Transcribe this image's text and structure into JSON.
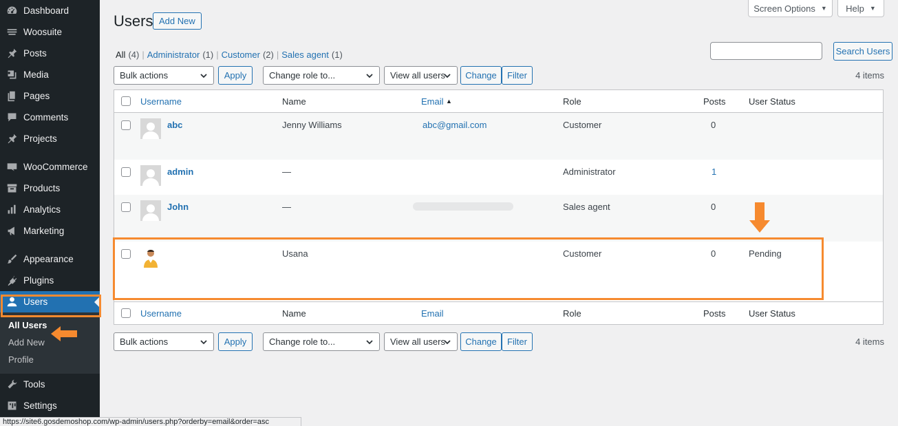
{
  "sidebar": {
    "items": [
      {
        "label": "Dashboard",
        "icon": "dashboard-icon"
      },
      {
        "label": "Woosuite",
        "icon": "woosuite-icon"
      },
      {
        "label": "Posts",
        "icon": "pin-icon"
      },
      {
        "label": "Media",
        "icon": "media-icon"
      },
      {
        "label": "Pages",
        "icon": "pages-icon"
      },
      {
        "label": "Comments",
        "icon": "comment-icon"
      },
      {
        "label": "Projects",
        "icon": "pin-icon"
      },
      {
        "label": "WooCommerce",
        "icon": "woocommerce-icon"
      },
      {
        "label": "Products",
        "icon": "archive-icon"
      },
      {
        "label": "Analytics",
        "icon": "bar-chart-icon"
      },
      {
        "label": "Marketing",
        "icon": "megaphone-icon"
      },
      {
        "label": "Appearance",
        "icon": "brush-icon"
      },
      {
        "label": "Plugins",
        "icon": "plugin-icon"
      },
      {
        "label": "Users",
        "icon": "user-icon"
      },
      {
        "label": "Tools",
        "icon": "wrench-icon"
      },
      {
        "label": "Settings",
        "icon": "settings-icon"
      }
    ],
    "submenu": [
      "All Users",
      "Add New",
      "Profile"
    ]
  },
  "header": {
    "screen_options": "Screen Options",
    "help": "Help",
    "title": "Users",
    "add_new": "Add New"
  },
  "filters": {
    "all": "All",
    "all_count": "(4)",
    "administrator": "Administrator",
    "administrator_count": "(1)",
    "customer": "Customer",
    "customer_count": "(2)",
    "sales_agent": "Sales agent",
    "sales_agent_count": "(1)",
    "separator": "|"
  },
  "search": {
    "button": "Search Users",
    "value": ""
  },
  "tablenav": {
    "bulk_actions": "Bulk actions",
    "apply": "Apply",
    "change_role": "Change role to...",
    "view_all_users": "View all users",
    "change": "Change",
    "filter": "Filter",
    "items_count": "4 items"
  },
  "table": {
    "columns": {
      "username": "Username",
      "name": "Name",
      "email": "Email",
      "role": "Role",
      "posts": "Posts",
      "user_status": "User Status"
    },
    "rows": [
      {
        "username": "abc",
        "name": "Jenny Williams",
        "email": "abc@gmail.com",
        "role": "Customer",
        "posts": "0",
        "status": ""
      },
      {
        "username": "admin",
        "name": "—",
        "email": "",
        "role": "Administrator",
        "posts": "1",
        "status": ""
      },
      {
        "username": "John",
        "name": "—",
        "email": "",
        "role": "Sales agent",
        "posts": "0",
        "status": ""
      },
      {
        "username": "",
        "name": "Usana",
        "email": "",
        "role": "Customer",
        "posts": "0",
        "status": "Pending"
      }
    ]
  },
  "colors": {
    "sidebar_bg": "#1d2327",
    "accent": "#2271b1",
    "highlight": "#f68a2f"
  },
  "statusbar": {
    "url": "https://site6.gosdemoshop.com/wp-admin/users.php?orderby=email&order=asc"
  }
}
